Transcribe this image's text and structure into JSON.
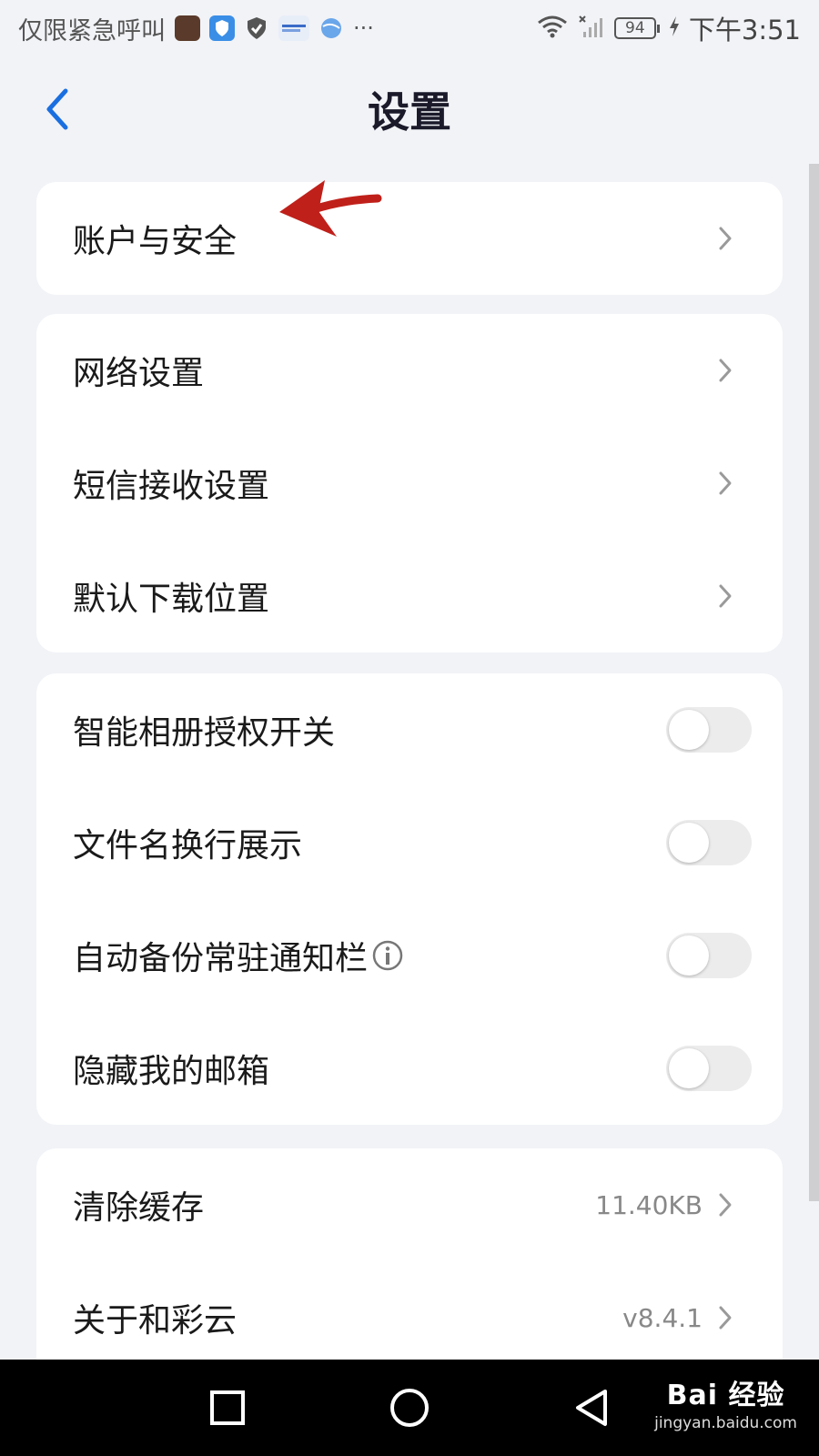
{
  "status_bar": {
    "carrier_text": "仅限紧急呼叫",
    "overflow": "···",
    "battery": "94",
    "time": "下午3:51"
  },
  "header": {
    "title": "设置"
  },
  "groups": [
    {
      "items": [
        {
          "label": "账户与安全",
          "control": "chevron"
        }
      ]
    },
    {
      "items": [
        {
          "label": "网络设置",
          "control": "chevron"
        },
        {
          "label": "短信接收设置",
          "control": "chevron"
        },
        {
          "label": "默认下载位置",
          "control": "chevron"
        }
      ]
    },
    {
      "items": [
        {
          "label": "智能相册授权开关",
          "control": "toggle",
          "on": false
        },
        {
          "label": "文件名换行展示",
          "control": "toggle",
          "on": false
        },
        {
          "label": "自动备份常驻通知栏",
          "control": "toggle",
          "on": false,
          "info_icon": true
        },
        {
          "label": "隐藏我的邮箱",
          "control": "toggle",
          "on": false
        }
      ]
    },
    {
      "items": [
        {
          "label": "清除缓存",
          "control": "chevron",
          "value": "11.40KB"
        },
        {
          "label": "关于和彩云",
          "control": "chevron",
          "value": "v8.4.1"
        }
      ]
    }
  ],
  "watermark": {
    "logo": "Bai 经验",
    "url": "jingyan.baidu.com"
  },
  "colors": {
    "accent": "#1a6fe0",
    "background": "#f2f3f7",
    "card": "#ffffff",
    "annotation": "#c0201a"
  },
  "icons": {
    "back": "chevron-left-icon",
    "row": "chevron-right-icon",
    "info": "info-circle-icon",
    "annotation": "red-arrow-icon"
  }
}
